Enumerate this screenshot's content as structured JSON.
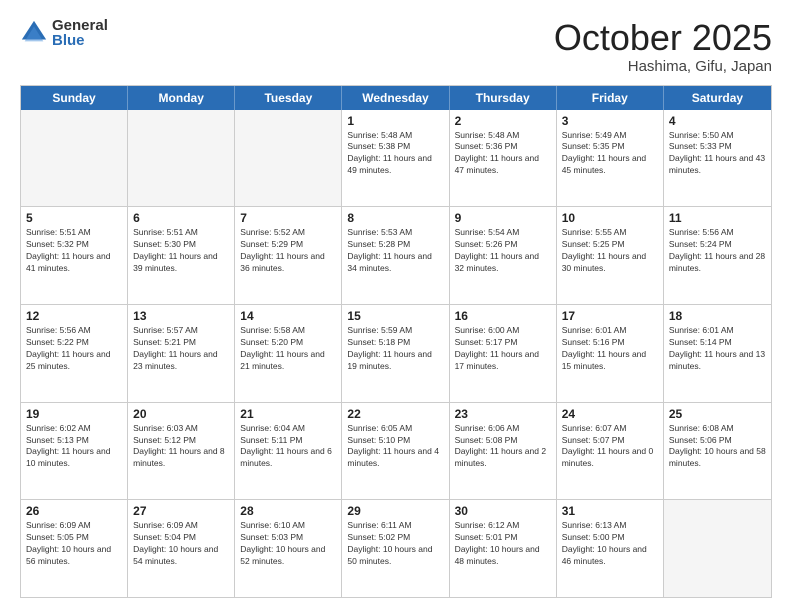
{
  "header": {
    "logo": {
      "general": "General",
      "blue": "Blue"
    },
    "title": "October 2025",
    "location": "Hashima, Gifu, Japan"
  },
  "weekdays": [
    "Sunday",
    "Monday",
    "Tuesday",
    "Wednesday",
    "Thursday",
    "Friday",
    "Saturday"
  ],
  "rows": [
    [
      {
        "day": "",
        "empty": true
      },
      {
        "day": "",
        "empty": true
      },
      {
        "day": "",
        "empty": true
      },
      {
        "day": "1",
        "sunrise": "Sunrise: 5:48 AM",
        "sunset": "Sunset: 5:38 PM",
        "daylight": "Daylight: 11 hours and 49 minutes."
      },
      {
        "day": "2",
        "sunrise": "Sunrise: 5:48 AM",
        "sunset": "Sunset: 5:36 PM",
        "daylight": "Daylight: 11 hours and 47 minutes."
      },
      {
        "day": "3",
        "sunrise": "Sunrise: 5:49 AM",
        "sunset": "Sunset: 5:35 PM",
        "daylight": "Daylight: 11 hours and 45 minutes."
      },
      {
        "day": "4",
        "sunrise": "Sunrise: 5:50 AM",
        "sunset": "Sunset: 5:33 PM",
        "daylight": "Daylight: 11 hours and 43 minutes."
      }
    ],
    [
      {
        "day": "5",
        "sunrise": "Sunrise: 5:51 AM",
        "sunset": "Sunset: 5:32 PM",
        "daylight": "Daylight: 11 hours and 41 minutes."
      },
      {
        "day": "6",
        "sunrise": "Sunrise: 5:51 AM",
        "sunset": "Sunset: 5:30 PM",
        "daylight": "Daylight: 11 hours and 39 minutes."
      },
      {
        "day": "7",
        "sunrise": "Sunrise: 5:52 AM",
        "sunset": "Sunset: 5:29 PM",
        "daylight": "Daylight: 11 hours and 36 minutes."
      },
      {
        "day": "8",
        "sunrise": "Sunrise: 5:53 AM",
        "sunset": "Sunset: 5:28 PM",
        "daylight": "Daylight: 11 hours and 34 minutes."
      },
      {
        "day": "9",
        "sunrise": "Sunrise: 5:54 AM",
        "sunset": "Sunset: 5:26 PM",
        "daylight": "Daylight: 11 hours and 32 minutes."
      },
      {
        "day": "10",
        "sunrise": "Sunrise: 5:55 AM",
        "sunset": "Sunset: 5:25 PM",
        "daylight": "Daylight: 11 hours and 30 minutes."
      },
      {
        "day": "11",
        "sunrise": "Sunrise: 5:56 AM",
        "sunset": "Sunset: 5:24 PM",
        "daylight": "Daylight: 11 hours and 28 minutes."
      }
    ],
    [
      {
        "day": "12",
        "sunrise": "Sunrise: 5:56 AM",
        "sunset": "Sunset: 5:22 PM",
        "daylight": "Daylight: 11 hours and 25 minutes."
      },
      {
        "day": "13",
        "sunrise": "Sunrise: 5:57 AM",
        "sunset": "Sunset: 5:21 PM",
        "daylight": "Daylight: 11 hours and 23 minutes."
      },
      {
        "day": "14",
        "sunrise": "Sunrise: 5:58 AM",
        "sunset": "Sunset: 5:20 PM",
        "daylight": "Daylight: 11 hours and 21 minutes."
      },
      {
        "day": "15",
        "sunrise": "Sunrise: 5:59 AM",
        "sunset": "Sunset: 5:18 PM",
        "daylight": "Daylight: 11 hours and 19 minutes."
      },
      {
        "day": "16",
        "sunrise": "Sunrise: 6:00 AM",
        "sunset": "Sunset: 5:17 PM",
        "daylight": "Daylight: 11 hours and 17 minutes."
      },
      {
        "day": "17",
        "sunrise": "Sunrise: 6:01 AM",
        "sunset": "Sunset: 5:16 PM",
        "daylight": "Daylight: 11 hours and 15 minutes."
      },
      {
        "day": "18",
        "sunrise": "Sunrise: 6:01 AM",
        "sunset": "Sunset: 5:14 PM",
        "daylight": "Daylight: 11 hours and 13 minutes."
      }
    ],
    [
      {
        "day": "19",
        "sunrise": "Sunrise: 6:02 AM",
        "sunset": "Sunset: 5:13 PM",
        "daylight": "Daylight: 11 hours and 10 minutes."
      },
      {
        "day": "20",
        "sunrise": "Sunrise: 6:03 AM",
        "sunset": "Sunset: 5:12 PM",
        "daylight": "Daylight: 11 hours and 8 minutes."
      },
      {
        "day": "21",
        "sunrise": "Sunrise: 6:04 AM",
        "sunset": "Sunset: 5:11 PM",
        "daylight": "Daylight: 11 hours and 6 minutes."
      },
      {
        "day": "22",
        "sunrise": "Sunrise: 6:05 AM",
        "sunset": "Sunset: 5:10 PM",
        "daylight": "Daylight: 11 hours and 4 minutes."
      },
      {
        "day": "23",
        "sunrise": "Sunrise: 6:06 AM",
        "sunset": "Sunset: 5:08 PM",
        "daylight": "Daylight: 11 hours and 2 minutes."
      },
      {
        "day": "24",
        "sunrise": "Sunrise: 6:07 AM",
        "sunset": "Sunset: 5:07 PM",
        "daylight": "Daylight: 11 hours and 0 minutes."
      },
      {
        "day": "25",
        "sunrise": "Sunrise: 6:08 AM",
        "sunset": "Sunset: 5:06 PM",
        "daylight": "Daylight: 10 hours and 58 minutes."
      }
    ],
    [
      {
        "day": "26",
        "sunrise": "Sunrise: 6:09 AM",
        "sunset": "Sunset: 5:05 PM",
        "daylight": "Daylight: 10 hours and 56 minutes."
      },
      {
        "day": "27",
        "sunrise": "Sunrise: 6:09 AM",
        "sunset": "Sunset: 5:04 PM",
        "daylight": "Daylight: 10 hours and 54 minutes."
      },
      {
        "day": "28",
        "sunrise": "Sunrise: 6:10 AM",
        "sunset": "Sunset: 5:03 PM",
        "daylight": "Daylight: 10 hours and 52 minutes."
      },
      {
        "day": "29",
        "sunrise": "Sunrise: 6:11 AM",
        "sunset": "Sunset: 5:02 PM",
        "daylight": "Daylight: 10 hours and 50 minutes."
      },
      {
        "day": "30",
        "sunrise": "Sunrise: 6:12 AM",
        "sunset": "Sunset: 5:01 PM",
        "daylight": "Daylight: 10 hours and 48 minutes."
      },
      {
        "day": "31",
        "sunrise": "Sunrise: 6:13 AM",
        "sunset": "Sunset: 5:00 PM",
        "daylight": "Daylight: 10 hours and 46 minutes."
      },
      {
        "day": "",
        "empty": true
      }
    ]
  ]
}
